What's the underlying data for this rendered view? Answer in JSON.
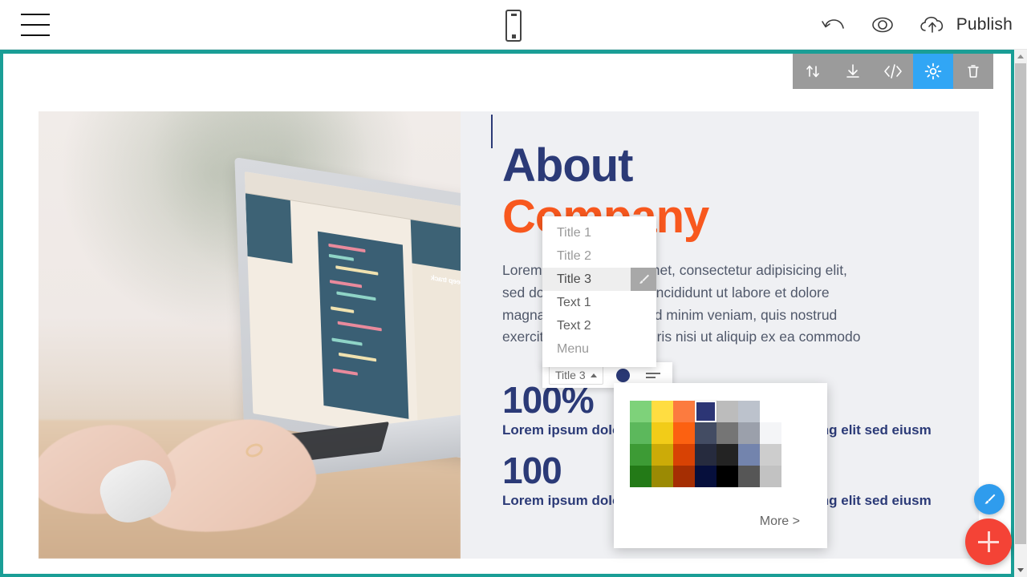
{
  "topbar": {
    "menu_icon": "hamburger-menu-icon",
    "device_icon": "mobile-device-icon",
    "undo_icon": "undo-arrow-icon",
    "preview_icon": "eye-preview-icon",
    "publish_icon": "cloud-upload-icon",
    "publish_label": "Publish"
  },
  "block_toolbar": {
    "items": [
      {
        "name": "move-block-icon",
        "label": "Move block"
      },
      {
        "name": "download-icon",
        "label": "Download"
      },
      {
        "name": "code-editor-icon",
        "label": "Edit code"
      },
      {
        "name": "settings-gear-icon",
        "label": "Block settings"
      },
      {
        "name": "trash-delete-icon",
        "label": "Delete block"
      }
    ],
    "active_index": 3,
    "active_color": "#31a6f5",
    "bar_color": "#9b9b9b"
  },
  "section": {
    "heading_line1": "About",
    "heading_line2": "Company",
    "heading_color1": "#2b3a77",
    "heading_color2": "#f8581e",
    "body_lines": [
      "Lorem ipsum dolor sit amet, consectetur adipisicing elit,",
      "sed do eiusmod tempor incididunt ut labore et dolore",
      "magna aliqua. Ut enim ad minim veniam, quis nostrud",
      "exercitation ullamco laboris nisi ut aliquip ex ea commodo"
    ],
    "stats": [
      {
        "number": "100%",
        "label": "Lorem ipsum dolor sit amet consectetur adipisicing elit sed eiusm"
      },
      {
        "number": "100",
        "label": "Lorem ipsum dolor sit amet consectetur adipisicing elit sed eiusm"
      }
    ],
    "photo_alt": "hands-typing-on-laptop-photo",
    "screen_text": "Keep track"
  },
  "type_dropdown": {
    "items": [
      {
        "label": "Title 1",
        "selected": false,
        "tone": "light"
      },
      {
        "label": "Title 2",
        "selected": false,
        "tone": "light"
      },
      {
        "label": "Title 3",
        "selected": true,
        "tone": "dark"
      },
      {
        "label": "Text 1",
        "selected": false,
        "tone": "dark"
      },
      {
        "label": "Text 2",
        "selected": false,
        "tone": "dark"
      },
      {
        "label": "Menu",
        "selected": false,
        "tone": "light"
      }
    ],
    "brush_icon": "paintbrush-icon"
  },
  "format_bar": {
    "type_value": "Title 3",
    "caret_icon": "chevron-up-icon",
    "color_dot": "#2b3a77",
    "align_icon": "text-align-icon"
  },
  "color_popup": {
    "more_label": "More >",
    "selected_index": 3,
    "swatches": [
      "#7ed27a",
      "#ffdd41",
      "#fc7b3f",
      "#2c3575",
      "#bcbcbc",
      "#bcc2cc",
      "#ffffff",
      "#5cb85c",
      "#f2cc18",
      "#fc6111",
      "#434c63",
      "#757575",
      "#9ba0ab",
      "#f4f5f7",
      "#3d9b35",
      "#ccab08",
      "#d84204",
      "#262b3e",
      "#232323",
      "#7384ad",
      "#cdcdcd",
      "#237a17",
      "#9b8a04",
      "#a52e03",
      "#060f3c",
      "#000000",
      "#565656",
      "#c2c2c2"
    ]
  },
  "fabs": {
    "brush": {
      "name": "paintbrush-fab",
      "color": "#2f9ced"
    },
    "add": {
      "name": "add-block-fab",
      "color": "#f44336"
    }
  },
  "scrollbar": {
    "up_icon": "scroll-up-arrow-icon",
    "down_icon": "scroll-down-arrow-icon"
  },
  "colors": {
    "canvas_border": "#1a9e96",
    "section_bg": "#eff0f3"
  }
}
